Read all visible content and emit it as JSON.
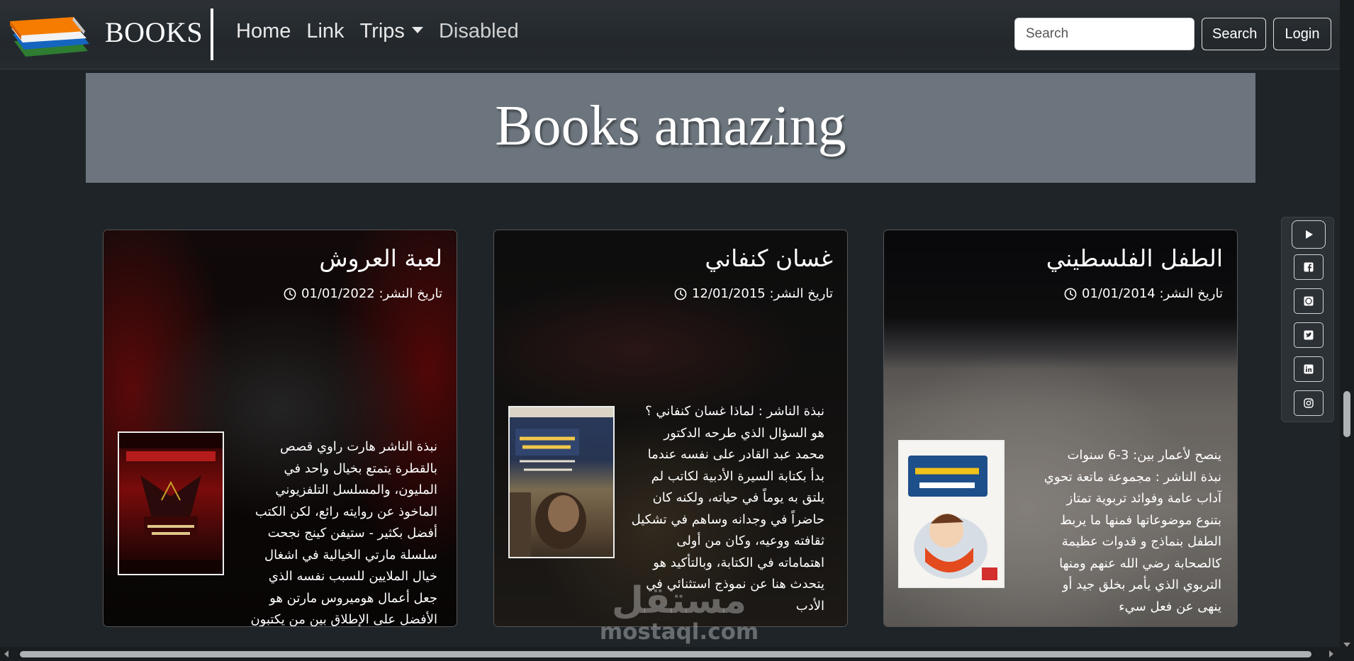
{
  "navbar": {
    "brand": "BOOKS",
    "links": [
      {
        "label": "Home"
      },
      {
        "label": "Link"
      },
      {
        "label": "Trips"
      },
      {
        "label": "Disabled"
      }
    ],
    "search_placeholder": "Search",
    "search_button": "Search",
    "login_button": "Login"
  },
  "hero": {
    "title": "Books amazing"
  },
  "cards": [
    {
      "title": "لعبة العروش",
      "date_label": "تاريخ النشر: 01/01/2022",
      "lines": [
        "نبذة الناشر هارت راوي قصص",
        "بالقطرة يتمتع بخيال واحد في",
        "المليون، والمسلسل التلفزيوني",
        "الماخوذ عن روايته رائع، لكن الكتب",
        "أفضل بكثير - ستيفن كينج نجحت",
        "سلسلة مارتي الخيالية في اشغال",
        "خيال الملايين للسبب نفسه الذي",
        "جعل أعمال هوميروس مارتن هو",
        "الأفضل على الإطلاق بين من يكتبون"
      ]
    },
    {
      "title": "غسان كنفاني",
      "date_label": "تاريخ النشر: 12/01/2015",
      "lines": [
        "نبذة الناشر : لماذا غسان كنفاني ؟",
        "هو السؤال الذي طرحه الدكتور",
        "محمد عبد القادر على نفسه عندما",
        "بدأ بكتابة السيرة الأدبية لكاتب لم",
        "يلتق به يوماً في حياته، ولكنه كان",
        "حاضراً في وجدانه وساهم في تشكيل",
        "ثقافته ووعيه، وكان من أولى",
        "اهتماماته في الكتابة، وبالتأكيد هو",
        "يتحدث هنا عن نموذج استثنائي في",
        "الأدب"
      ]
    },
    {
      "title": "الطفل الفلسطيني",
      "date_label": "تاريخ النشر: 01/01/2014",
      "lines": [
        "ينصح لأعمار بين: 3-6 سنوات",
        "نبذة الناشر : مجموعة ماتعة تحوي",
        "آداب عامة وفوائد تربوية تمتاز",
        "بتنوع موضوعاتها فمنها ما يربط",
        "الطفل بنماذج و قدوات عظيمة",
        "كالصحابة رضي الله عنهم ومنها",
        "التربوي الذي يأمر بخلق جيد أو",
        "ينهى عن فعل سيء"
      ]
    }
  ],
  "social": [
    "youtube-icon",
    "facebook-icon",
    "whatsapp-icon",
    "twitter-icon",
    "linkedin-icon",
    "instagram-icon"
  ],
  "watermark": {
    "arabic": "مستقل",
    "latin": "mostaql.com"
  }
}
